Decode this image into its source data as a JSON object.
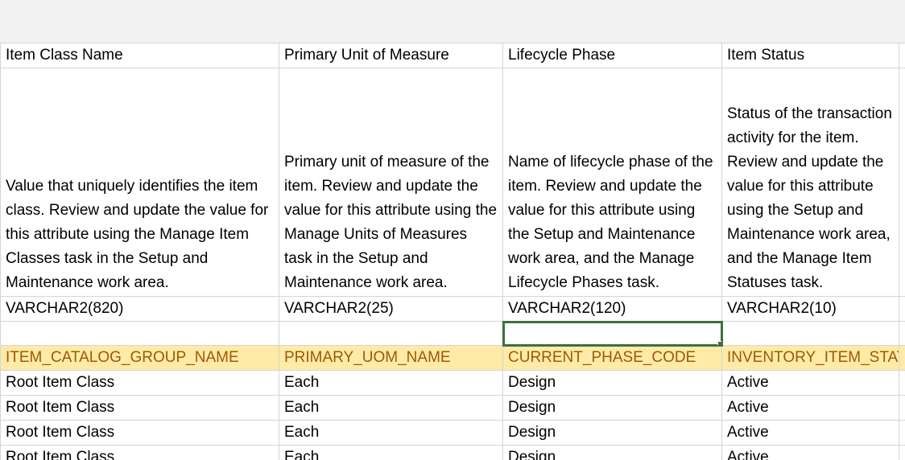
{
  "columns": [
    {
      "header": "Item Class Name",
      "description": "Value that uniquely identifies the item class. Review and update the value for this attribute using the Manage Item Classes task in the Setup and Maintenance work area.",
      "data_type": "VARCHAR2(820)",
      "technical_name": "ITEM_CATALOG_GROUP_NAME"
    },
    {
      "header": "Primary Unit of Measure",
      "description": "Primary unit of measure of the item. Review and update the value for this attribute using the Manage Units of Measures task in the Setup and Maintenance work area.",
      "data_type": "VARCHAR2(25)",
      "technical_name": "PRIMARY_UOM_NAME"
    },
    {
      "header": "Lifecycle Phase",
      "description": "Name of lifecycle phase of the item. Review and update the value for this attribute using the Setup and Maintenance work area, and the Manage Lifecycle Phases task.",
      "data_type": "VARCHAR2(120)",
      "technical_name": "CURRENT_PHASE_CODE"
    },
    {
      "header": "Item Status",
      "description": "Status of the transaction activity for the item. Review and update the value for this attribute using the Setup and Maintenance work area, and the Manage Item Statuses task.",
      "data_type": "VARCHAR2(10)",
      "technical_name": "INVENTORY_ITEM_STATU"
    }
  ],
  "rows": [
    [
      "Root Item Class",
      "Each",
      "Design",
      "Active"
    ],
    [
      "Root Item Class",
      "Each",
      "Design",
      "Active"
    ],
    [
      "Root Item Class",
      "Each",
      "Design",
      "Active"
    ],
    [
      "Root Item Class",
      "Each",
      "Design",
      "Active"
    ]
  ],
  "selection": {
    "row": "empty",
    "column": 2,
    "border_color": "#3e6f3f"
  },
  "colors": {
    "technical_row_bg": "#ffeaa8",
    "technical_row_text": "#9c5a00"
  }
}
